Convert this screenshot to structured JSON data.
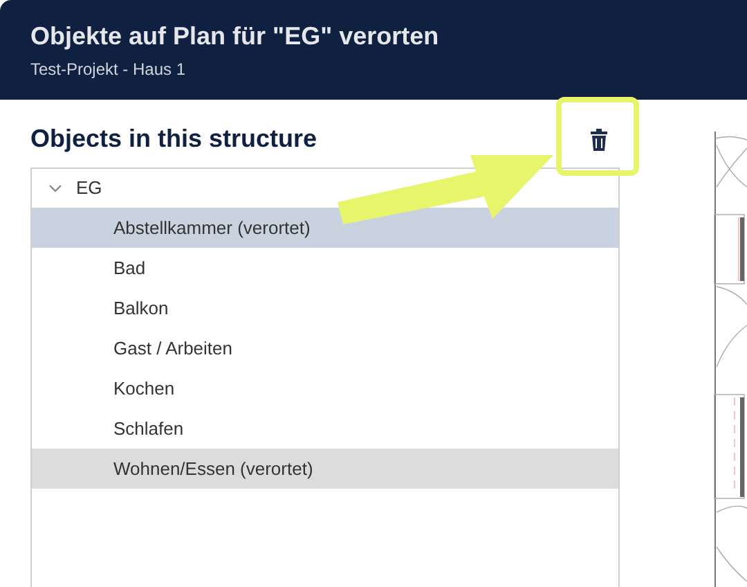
{
  "header": {
    "title": "Objekte auf Plan für \"EG\" verorten",
    "subtitle": "Test-Projekt - Haus 1"
  },
  "panel": {
    "heading": "Objects in this structure"
  },
  "tree": [
    {
      "label": "EG",
      "expanded": true,
      "children": [
        {
          "label": "Abstellkammer (verortet)",
          "selected": true,
          "hovered": false
        },
        {
          "label": "Bad",
          "selected": false,
          "hovered": false
        },
        {
          "label": "Balkon",
          "selected": false,
          "hovered": false
        },
        {
          "label": "Gast / Arbeiten",
          "selected": false,
          "hovered": false
        },
        {
          "label": "Kochen",
          "selected": false,
          "hovered": false
        },
        {
          "label": "Schlafen",
          "selected": false,
          "hovered": false
        },
        {
          "label": "Wohnen/Essen (verortet)",
          "selected": false,
          "hovered": true
        }
      ]
    }
  ]
}
